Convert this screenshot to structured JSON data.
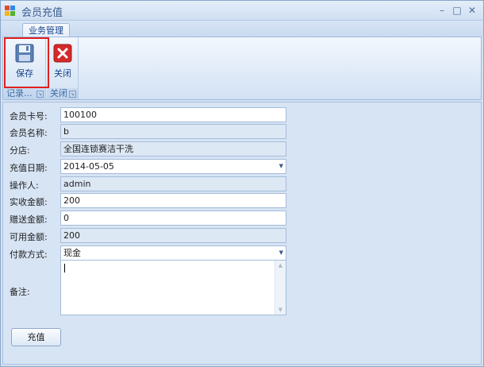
{
  "window": {
    "title": "会员充值"
  },
  "ribbon": {
    "tab": "业务管理",
    "groups": [
      {
        "label": "记录...",
        "button": "保存",
        "icon": "save-icon"
      },
      {
        "label": "关闭",
        "button": "关闭",
        "icon": "close-icon"
      }
    ]
  },
  "form": {
    "card_no": {
      "label": "会员卡号:",
      "value": "100100"
    },
    "member_name": {
      "label": "会员名称:",
      "value": "b"
    },
    "branch": {
      "label": "分店:",
      "value": "全国连锁赛洁干洗"
    },
    "charge_date": {
      "label": "充值日期:",
      "value": "2014-05-05"
    },
    "operator": {
      "label": "操作人:",
      "value": "admin"
    },
    "received": {
      "label": "实收金额:",
      "value": "200"
    },
    "bonus": {
      "label": "赠送金额:",
      "value": "0"
    },
    "available": {
      "label": "可用金额:",
      "value": "200"
    },
    "payment": {
      "label": "付款方式:",
      "value": "现金"
    },
    "remark": {
      "label": "备注:",
      "value": ""
    }
  },
  "actions": {
    "charge": "充值"
  },
  "colors": {
    "accent": "#15428b",
    "highlight": "#e02020",
    "close_red": "#d42a2a"
  }
}
